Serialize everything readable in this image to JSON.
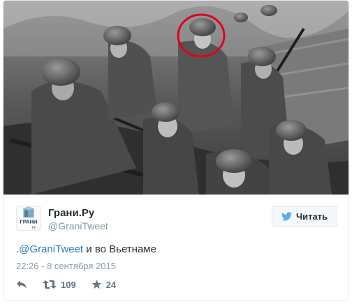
{
  "photo": {
    "highlight_color": "#e0001b"
  },
  "author": {
    "avatar_text": "ГРАНИ",
    "avatar_subtext": "ру",
    "name": "Грани.Ру",
    "handle": "@GraniTweet"
  },
  "follow": {
    "label": "Читать",
    "icon": "twitter-bird-icon"
  },
  "tweet": {
    "prefix": ".",
    "mention": "@GraniTweet",
    "rest": " и во Вьетнаме",
    "timestamp": "22:26 - 8 сентября 2015"
  },
  "actions": {
    "reply_icon": "reply-icon",
    "retweet_icon": "retweet-icon",
    "retweet_count": "109",
    "like_icon": "star-icon",
    "like_count": "24"
  },
  "colors": {
    "link": "#2b7bb9",
    "muted": "#8899a6",
    "text": "#292f33",
    "border": "#e1e8ed"
  }
}
